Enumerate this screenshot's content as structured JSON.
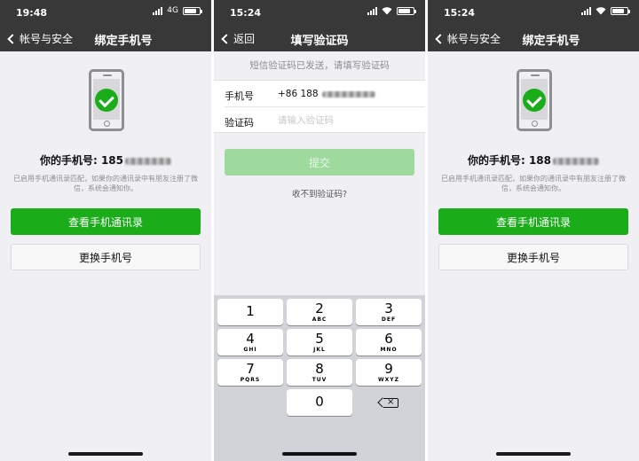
{
  "screens": {
    "bind_left": {
      "status": {
        "time": "19:48",
        "network": "4G"
      },
      "nav": {
        "back_label": "帐号与安全",
        "title": "绑定手机号"
      },
      "phone_label": "你的手机号: 185",
      "hint": "已启用手机通讯录匹配，如果你的通讯录中有朋友注册了微信，系统会通知你。",
      "view_contacts_label": "查看手机通讯录",
      "change_phone_label": "更换手机号"
    },
    "verify": {
      "status": {
        "time": "15:24"
      },
      "nav": {
        "back_label": "返回",
        "title": "填写验证码"
      },
      "sent_hint": "短信验证码已发送，请填写验证码",
      "phone_field_label": "手机号",
      "phone_value": "+86 188",
      "code_field_label": "验证码",
      "code_placeholder": "请输入验证码",
      "submit_label": "提交",
      "no_code_label": "收不到验证码?",
      "keypad": [
        {
          "num": "1",
          "letters": ""
        },
        {
          "num": "2",
          "letters": "ABC"
        },
        {
          "num": "3",
          "letters": "DEF"
        },
        {
          "num": "4",
          "letters": "GHI"
        },
        {
          "num": "5",
          "letters": "JKL"
        },
        {
          "num": "6",
          "letters": "MNO"
        },
        {
          "num": "7",
          "letters": "PQRS"
        },
        {
          "num": "8",
          "letters": "TUV"
        },
        {
          "num": "9",
          "letters": "WXYZ"
        },
        {
          "num": "0",
          "letters": ""
        }
      ],
      "delete_key_icon": "backspace-icon"
    },
    "bind_right": {
      "status": {
        "time": "15:24"
      },
      "nav": {
        "back_label": "帐号与安全",
        "title": "绑定手机号"
      },
      "phone_label": "你的手机号: 188",
      "hint": "已启用手机通讯录匹配，如果你的通讯录中有朋友注册了微信，系统会通知你。",
      "view_contacts_label": "查看手机通讯录",
      "change_phone_label": "更换手机号"
    }
  },
  "colors": {
    "accent_green": "#1aad19",
    "disabled_green": "#9ed99d",
    "nav_dark": "#383838",
    "background": "#efeff4"
  },
  "icons": [
    "back-chevron-icon",
    "phone-illustration-icon",
    "checkmark-icon",
    "signal-icon",
    "wifi-icon",
    "battery-icon",
    "backspace-icon"
  ]
}
